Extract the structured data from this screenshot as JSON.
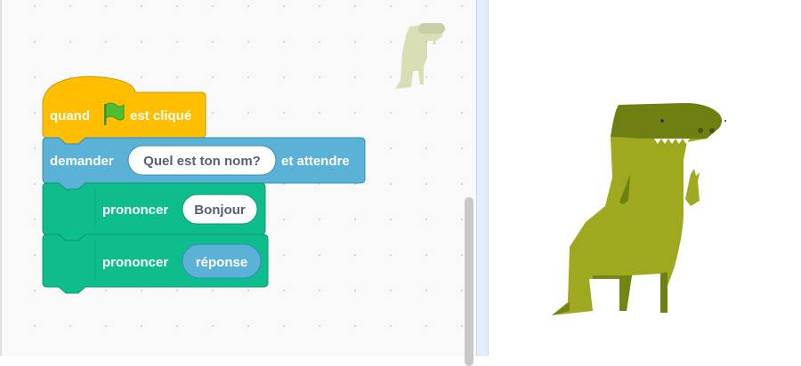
{
  "workspace": {
    "script": {
      "hat_block": {
        "before_label": "quand",
        "flag_icon": "green-flag-icon",
        "after_label": "est cliqué",
        "color": "#ffbf00"
      },
      "ask_block": {
        "label_before": "demander",
        "input_value": "Quel est ton nom?",
        "label_after": "et attendre",
        "color": "#5cb1d6"
      },
      "say_blocks": [
        {
          "label": "prononcer",
          "input_value": "Bonjour",
          "input_type": "text",
          "color": "#0fbd8c"
        },
        {
          "label": "prononcer",
          "input_value": "réponse",
          "input_type": "reporter",
          "color": "#0fbd8c"
        }
      ]
    },
    "sprite_thumbnail": "dinosaur-sprite-icon"
  },
  "stage": {
    "sprite": "dinosaur-sprite"
  }
}
